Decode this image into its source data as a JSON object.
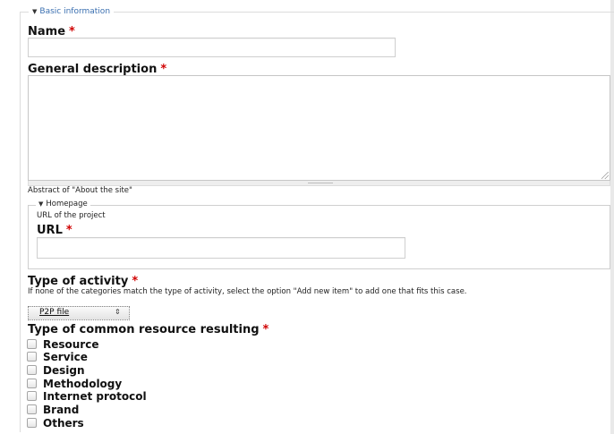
{
  "basic_info": {
    "legend": "Basic information",
    "name_label": "Name",
    "required_marker": "*",
    "name_value": "",
    "description_label": "General description",
    "description_value": "",
    "description_help": "Abstract of \"About the site\""
  },
  "homepage": {
    "legend": "Homepage",
    "help": "URL of the project",
    "url_label": "URL",
    "url_value": ""
  },
  "activity": {
    "label": "Type of activity",
    "help": "If none of the categories match the type of activity, select the option \"Add new item\" to add one that fits this case.",
    "selected": "P2P file"
  },
  "resource": {
    "label": "Type of common resource resulting",
    "options": [
      {
        "label": "Resource",
        "checked": false
      },
      {
        "label": "Service",
        "checked": false
      },
      {
        "label": "Design",
        "checked": false
      },
      {
        "label": "Methodology",
        "checked": false
      },
      {
        "label": "Internet protocol",
        "checked": false
      },
      {
        "label": "Brand",
        "checked": false
      },
      {
        "label": "Others",
        "checked": false
      }
    ]
  }
}
